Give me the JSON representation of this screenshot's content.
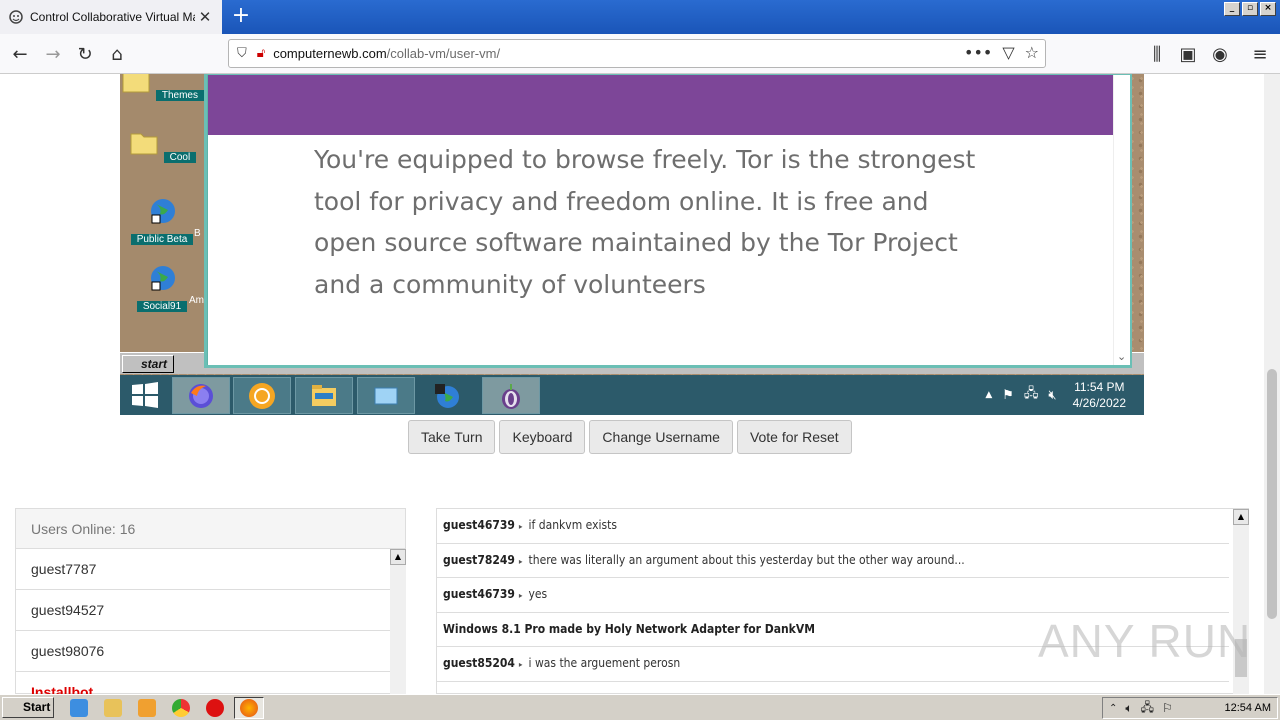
{
  "browser": {
    "tab_title": "Control Collaborative Virtual Machines",
    "url_domain": "computernewb.com",
    "url_path": "/collab-vm/user-vm/",
    "window_buttons": [
      "_",
      "▫",
      "×"
    ]
  },
  "vm": {
    "desktop_icons": [
      {
        "label": "Themes"
      },
      {
        "label": "Cool"
      },
      {
        "label": "Public Beta"
      },
      {
        "label": "Social91"
      }
    ],
    "desktop_partial_labels": [
      "B",
      "Am"
    ],
    "win98_start_label": "start",
    "tor_text": "You're equipped to browse freely. Tor is the strongest tool for privacy and freedom online. It is free and open source software maintained by the Tor Project and a community of volunteers",
    "clock_time": "11:54 PM",
    "clock_date": "4/26/2022"
  },
  "controls": {
    "take_turn": "Take Turn",
    "keyboard": "Keyboard",
    "change_username": "Change Username",
    "vote_reset": "Vote for Reset"
  },
  "users": {
    "header": "Users Online: 16",
    "list": [
      "guest7787",
      "guest94527",
      "guest98076",
      "Installbot"
    ]
  },
  "chat": {
    "messages": [
      {
        "nick": "guest46739",
        "text": "if dankvm exists"
      },
      {
        "nick": "guest78249",
        "text": "there was literally an argument about this yesterday but the other way around..."
      },
      {
        "nick": "guest46739",
        "text": "yes"
      },
      {
        "system": "Windows 8.1 Pro made by Holy Network Adapter for DankVM"
      },
      {
        "nick": "guest85204",
        "text": "i was the arguement perosn"
      }
    ]
  },
  "watermark": "ANY RUN",
  "host": {
    "start_label": "Start",
    "clock": "12:54 AM"
  },
  "colors": {
    "tor_purple": "#7d4698",
    "vm_taskbar": "#2c5a6a",
    "admin_name": "#dd0000"
  }
}
